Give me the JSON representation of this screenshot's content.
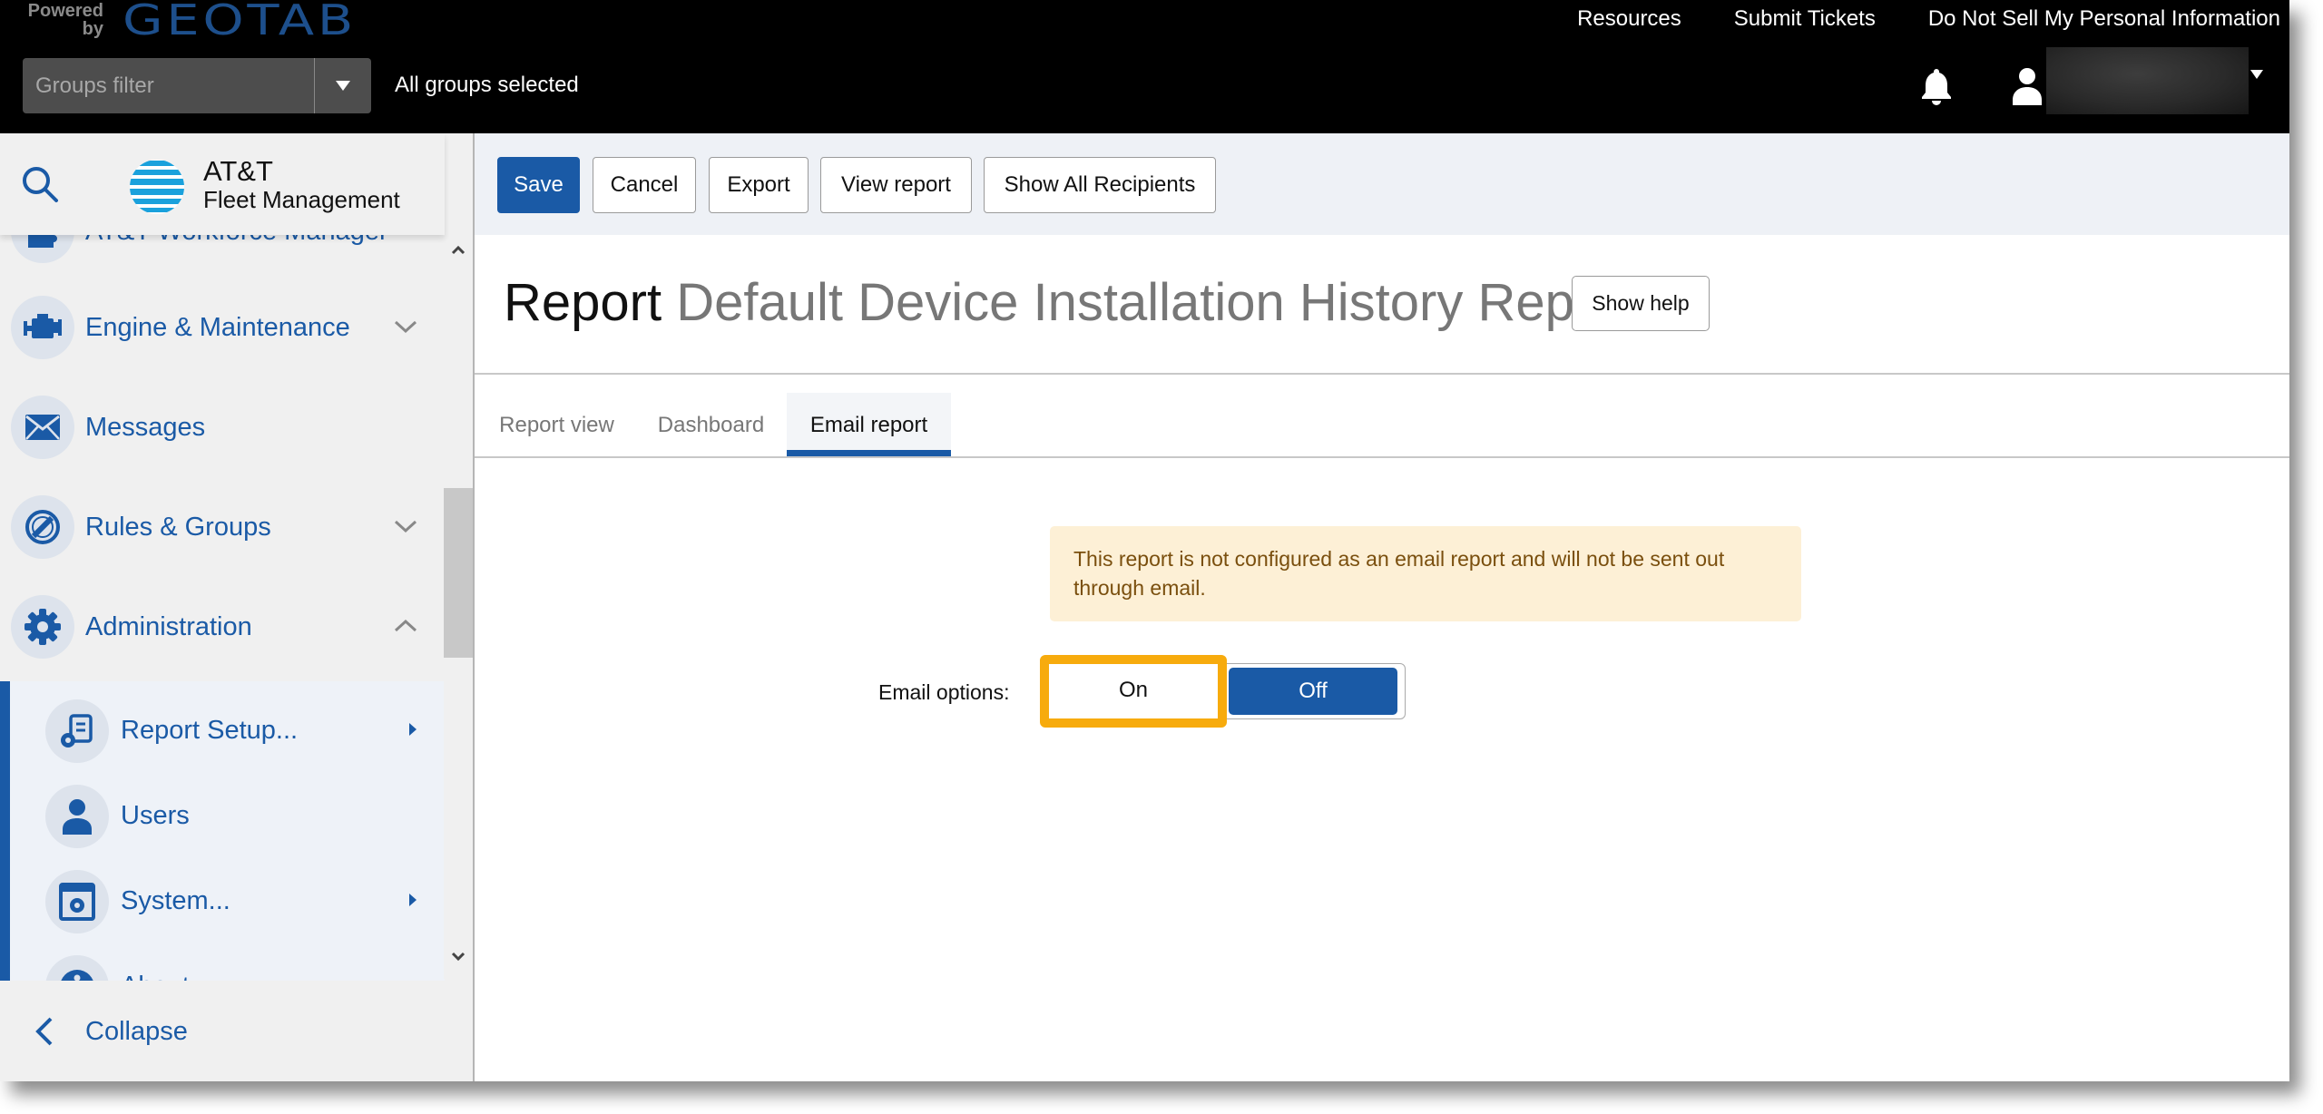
{
  "header": {
    "powered_by": "Powered by",
    "brand": "GEOTAB",
    "links": [
      "Resources",
      "Submit Tickets",
      "Do Not Sell My Personal Information"
    ],
    "groups_filter": {
      "placeholder": "Groups filter",
      "status": "All groups selected"
    },
    "icons": {
      "notifications": "bell-icon",
      "user": "user-icon",
      "user_menu": "caret-down-icon"
    }
  },
  "sidebar": {
    "search_icon": "search-icon",
    "logo": {
      "title": "AT&T",
      "subtitle": "Fleet Management"
    },
    "items": [
      {
        "label": "AT&T Workforce Manager",
        "icon": "puzzle-icon",
        "expand": "none"
      },
      {
        "label": "Engine & Maintenance",
        "icon": "engine-icon",
        "expand": "chevron-down"
      },
      {
        "label": "Messages",
        "icon": "envelope-icon",
        "expand": "none"
      },
      {
        "label": "Rules & Groups",
        "icon": "rules-icon",
        "expand": "chevron-down"
      },
      {
        "label": "Administration",
        "icon": "gear-icon",
        "expand": "chevron-up"
      }
    ],
    "sub_items": [
      {
        "label": "Report Setup...",
        "icon": "report-setup-icon",
        "has_submenu": true
      },
      {
        "label": "Users",
        "icon": "user-icon",
        "has_submenu": false
      },
      {
        "label": "System...",
        "icon": "system-settings-icon",
        "has_submenu": true
      },
      {
        "label": "About",
        "icon": "info-icon",
        "has_submenu": false
      }
    ],
    "collapse_label": "Collapse"
  },
  "toolbar": {
    "buttons": [
      "Save",
      "Cancel",
      "Export",
      "View report",
      "Show All Recipients"
    ]
  },
  "page": {
    "title_prefix": "Report",
    "title_name": "Default Device Installation History Report",
    "show_help": "Show help",
    "tabs": [
      {
        "label": "Report view",
        "active": false
      },
      {
        "label": "Dashboard",
        "active": false
      },
      {
        "label": "Email report",
        "active": true
      }
    ],
    "alert": "This report is not configured as an email report and will not be sent out through email.",
    "email_options": {
      "label": "Email options:",
      "on": "On",
      "off": "Off",
      "selected": "Off",
      "highlighted": "On"
    }
  },
  "colors": {
    "accent": "#1a5aa6",
    "highlight": "#f7ab0d",
    "alert_bg": "#fdf0d6",
    "alert_text": "#7a4f0e",
    "header_bg": "#000000"
  }
}
